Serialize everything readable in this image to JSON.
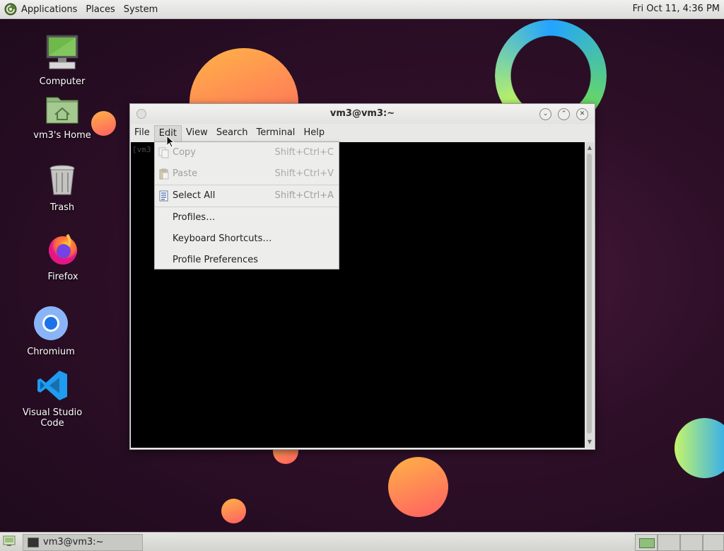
{
  "top_panel": {
    "applications": "Applications",
    "places": "Places",
    "system": "System",
    "clock": "Fri Oct 11,  4:36 PM"
  },
  "desktop": {
    "icons": [
      {
        "label": "Computer",
        "icon": "computer-icon"
      },
      {
        "label": "vm3's Home",
        "icon": "home-folder-icon"
      },
      {
        "label": "Trash",
        "icon": "trash-icon"
      },
      {
        "label": "Firefox",
        "icon": "firefox-icon"
      },
      {
        "label": "Chromium",
        "icon": "chromium-icon"
      },
      {
        "label": "Visual Studio Code",
        "icon": "vscode-icon"
      }
    ]
  },
  "window": {
    "title": "vm3@vm3:~",
    "menu": [
      "File",
      "Edit",
      "View",
      "Search",
      "Terminal",
      "Help"
    ],
    "active_menu": "Edit",
    "terminal_text": "[vm3"
  },
  "edit_menu": {
    "items": [
      {
        "label": "Copy",
        "accel": "Shift+Ctrl+C",
        "enabled": false,
        "icon": "copy-icon"
      },
      {
        "label": "Paste",
        "accel": "Shift+Ctrl+V",
        "enabled": false,
        "icon": "paste-icon"
      },
      {
        "label": "Select All",
        "accel": "Shift+Ctrl+A",
        "enabled": true,
        "icon": "select-all-icon"
      },
      {
        "label": "Profiles…",
        "accel": "",
        "enabled": true
      },
      {
        "label": "Keyboard Shortcuts…",
        "accel": "",
        "enabled": true
      },
      {
        "label": "Profile Preferences",
        "accel": "",
        "enabled": true
      }
    ]
  },
  "bottom_panel": {
    "task_label": "vm3@vm3:~"
  },
  "colors": {
    "desktop_bg": "#2e0f28",
    "panel_bg": "#dcdcd8",
    "terminal_bg": "#000000"
  }
}
